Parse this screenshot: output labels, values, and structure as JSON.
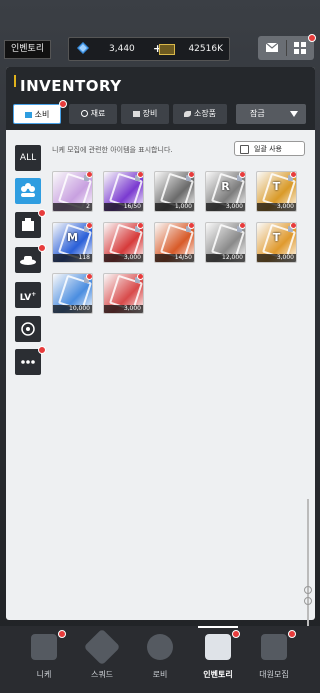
{
  "topbar": {
    "location": "인벤토리",
    "gem_value": "3,440",
    "gem_plus": "+",
    "cash_value": "42516K",
    "colors": {
      "gem": "#3a8fe0",
      "cash": "#d9b84a"
    }
  },
  "panel": {
    "title": "INVENTORY",
    "tabs": [
      {
        "label": "소비",
        "icon": "consumable-icon",
        "active": true
      },
      {
        "label": "재료",
        "icon": "material-icon",
        "active": false
      },
      {
        "label": "장비",
        "icon": "equipment-icon",
        "active": false
      },
      {
        "label": "소장품",
        "icon": "collection-icon",
        "active": false
      }
    ],
    "sort_label": "잠금",
    "hint": "니케 모집에 관련한 아이템을 표시합니다.",
    "bulk_use_label": "일괄 사용",
    "categories": [
      {
        "label": "ALL",
        "icon": null
      },
      {
        "label": "",
        "icon": "recruit-icon"
      },
      {
        "label": "",
        "icon": "inventory-icon"
      },
      {
        "label": "",
        "icon": "hat-icon"
      },
      {
        "label": "LV",
        "icon": null
      },
      {
        "label": "",
        "icon": "target-icon"
      },
      {
        "label": "",
        "icon": "more-icon"
      }
    ],
    "items": [
      {
        "count": "2",
        "glyph": "",
        "color": "#c8a0e0"
      },
      {
        "count": "16/50",
        "glyph": "",
        "color": "#7a3ad0"
      },
      {
        "count": "1,000",
        "glyph": "",
        "color": "#6a6a6a"
      },
      {
        "count": "3,000",
        "glyph": "R",
        "color": "#7d7d7d"
      },
      {
        "count": "3,000",
        "glyph": "T",
        "color": "#d99a28"
      },
      {
        "count": "118",
        "glyph": "M",
        "color": "#2a5fd8"
      },
      {
        "count": "3,000",
        "glyph": "",
        "color": "#d63a3a"
      },
      {
        "count": "14/50",
        "glyph": "",
        "color": "#d85a28"
      },
      {
        "count": "12,000",
        "glyph": "",
        "color": "#8a8a8a"
      },
      {
        "count": "3,000",
        "glyph": "T",
        "color": "#e09a2e"
      },
      {
        "count": "10,000",
        "glyph": "",
        "color": "#4a8de0"
      },
      {
        "count": "3,000",
        "glyph": "",
        "color": "#d84a4a"
      }
    ]
  },
  "bottom_nav": [
    {
      "label": "니케",
      "icon": "nikke-icon",
      "active": false
    },
    {
      "label": "스쿼드",
      "icon": "squad-icon",
      "active": false
    },
    {
      "label": "로비",
      "icon": "lobby-icon",
      "active": false
    },
    {
      "label": "인벤토리",
      "icon": "inventory-icon",
      "active": true
    },
    {
      "label": "대원모집",
      "icon": "recruit-clipboard-icon",
      "active": false
    }
  ]
}
